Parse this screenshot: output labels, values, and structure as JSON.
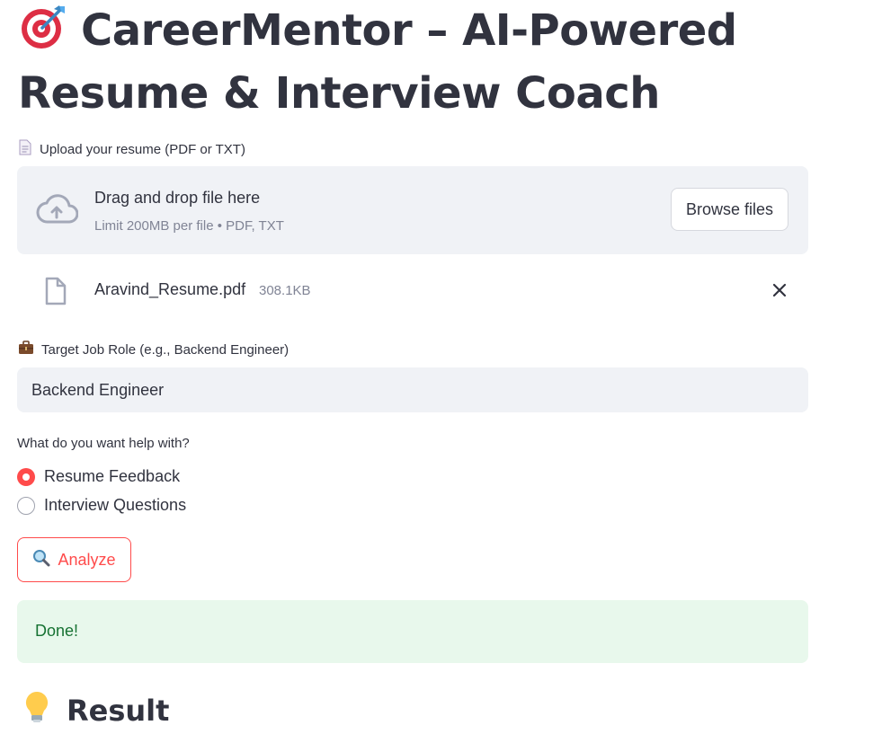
{
  "header": {
    "title": "CareerMentor – AI-Powered Resume & Interview Coach",
    "title_icon": "target-dart-icon"
  },
  "upload": {
    "label": "Upload your resume (PDF or TXT)",
    "label_icon": "document-icon",
    "dropzone_title": "Drag and drop file here",
    "dropzone_subtitle": "Limit 200MB per file • PDF, TXT",
    "browse_label": "Browse files",
    "file_name": "Aravind_Resume.pdf",
    "file_size": "308.1KB"
  },
  "role": {
    "label": "Target Job Role (e.g., Backend Engineer)",
    "label_icon": "briefcase-icon",
    "value": "Backend Engineer"
  },
  "help": {
    "label": "What do you want help with?",
    "options": [
      "Resume Feedback",
      "Interview Questions"
    ],
    "selected": "Resume Feedback"
  },
  "analyze": {
    "label": "Analyze",
    "icon": "magnifier-icon"
  },
  "status": {
    "message": "Done!"
  },
  "result": {
    "heading": "Result",
    "icon": "lightbulb-icon"
  },
  "colors": {
    "accent": "#ff4b4b",
    "text": "#31333f",
    "muted": "#808495",
    "input_bg": "#f0f2f6",
    "success_bg": "#e8f8ec",
    "success_text": "#177233"
  }
}
